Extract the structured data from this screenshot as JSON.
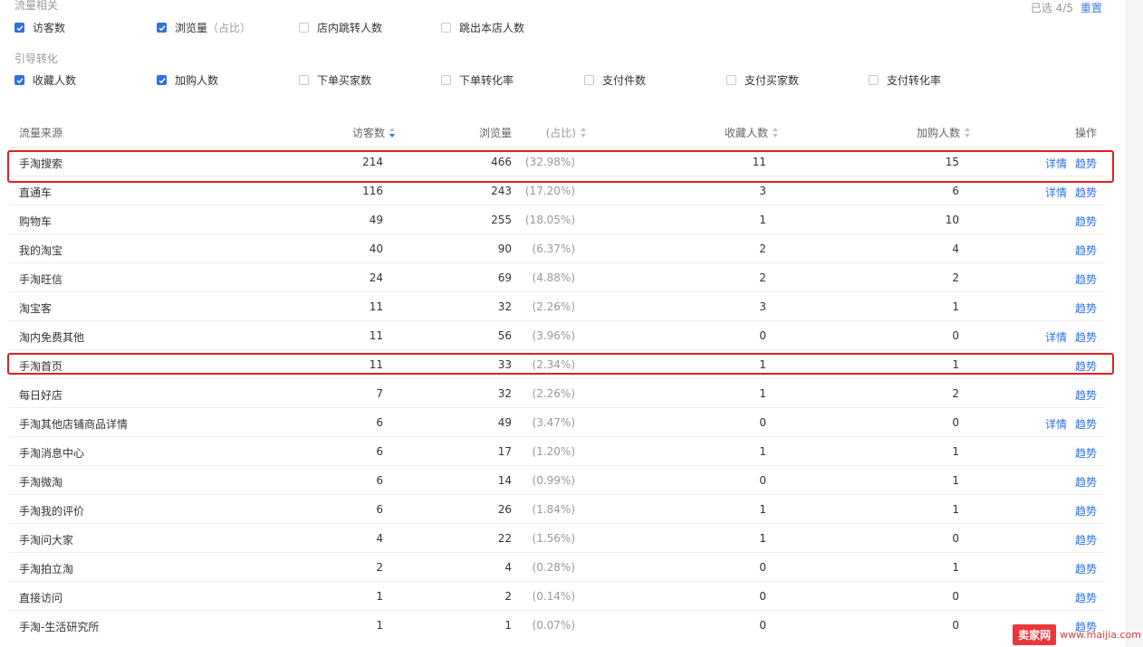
{
  "filters": {
    "traffic_title": "流量相关",
    "conversion_title": "引导转化",
    "selected_label": "已选 4/5",
    "reset_label": "重置",
    "traffic_options": [
      {
        "label": "访客数",
        "sub": "",
        "checked": true
      },
      {
        "label": "浏览量",
        "sub": "（占比）",
        "checked": true
      },
      {
        "label": "店内跳转人数",
        "sub": "",
        "checked": false
      },
      {
        "label": "跳出本店人数",
        "sub": "",
        "checked": false
      }
    ],
    "conversion_options": [
      {
        "label": "收藏人数",
        "checked": true
      },
      {
        "label": "加购人数",
        "checked": true
      },
      {
        "label": "下单买家数",
        "checked": false
      },
      {
        "label": "下单转化率",
        "checked": false
      },
      {
        "label": "支付件数",
        "checked": false
      },
      {
        "label": "支付买家数",
        "checked": false
      },
      {
        "label": "支付转化率",
        "checked": false
      }
    ]
  },
  "table": {
    "headers": {
      "source": "流量来源",
      "visitors": "访客数",
      "pv": "浏览量",
      "pct": "(占比)",
      "fav": "收藏人数",
      "cart": "加购人数",
      "ops": "操作"
    },
    "detail_label": "详情",
    "trend_label": "趋势",
    "rows": [
      {
        "source": "手淘搜索",
        "visitors": "214",
        "pv": "466",
        "pct": "(32.98%)",
        "fav": "11",
        "cart": "15",
        "detail": true
      },
      {
        "source": "直通车",
        "visitors": "116",
        "pv": "243",
        "pct": "(17.20%)",
        "fav": "3",
        "cart": "6",
        "detail": true
      },
      {
        "source": "购物车",
        "visitors": "49",
        "pv": "255",
        "pct": "(18.05%)",
        "fav": "1",
        "cart": "10",
        "detail": false
      },
      {
        "source": "我的淘宝",
        "visitors": "40",
        "pv": "90",
        "pct": "(6.37%)",
        "fav": "2",
        "cart": "4",
        "detail": false
      },
      {
        "source": "手淘旺信",
        "visitors": "24",
        "pv": "69",
        "pct": "(4.88%)",
        "fav": "2",
        "cart": "2",
        "detail": false
      },
      {
        "source": "淘宝客",
        "visitors": "11",
        "pv": "32",
        "pct": "(2.26%)",
        "fav": "3",
        "cart": "1",
        "detail": false
      },
      {
        "source": "淘内免费其他",
        "visitors": "11",
        "pv": "56",
        "pct": "(3.96%)",
        "fav": "0",
        "cart": "0",
        "detail": true
      },
      {
        "source": "手淘首页",
        "visitors": "11",
        "pv": "33",
        "pct": "(2.34%)",
        "fav": "1",
        "cart": "1",
        "detail": false
      },
      {
        "source": "每日好店",
        "visitors": "7",
        "pv": "32",
        "pct": "(2.26%)",
        "fav": "1",
        "cart": "2",
        "detail": false
      },
      {
        "source": "手淘其他店铺商品详情",
        "visitors": "6",
        "pv": "49",
        "pct": "(3.47%)",
        "fav": "0",
        "cart": "0",
        "detail": true
      },
      {
        "source": "手淘消息中心",
        "visitors": "6",
        "pv": "17",
        "pct": "(1.20%)",
        "fav": "1",
        "cart": "1",
        "detail": false
      },
      {
        "source": "手淘微淘",
        "visitors": "6",
        "pv": "14",
        "pct": "(0.99%)",
        "fav": "0",
        "cart": "1",
        "detail": false
      },
      {
        "source": "手淘我的评价",
        "visitors": "6",
        "pv": "26",
        "pct": "(1.84%)",
        "fav": "1",
        "cart": "1",
        "detail": false
      },
      {
        "source": "手淘问大家",
        "visitors": "4",
        "pv": "22",
        "pct": "(1.56%)",
        "fav": "1",
        "cart": "0",
        "detail": false
      },
      {
        "source": "手淘拍立淘",
        "visitors": "2",
        "pv": "4",
        "pct": "(0.28%)",
        "fav": "0",
        "cart": "1",
        "detail": false
      },
      {
        "source": "直接访问",
        "visitors": "1",
        "pv": "2",
        "pct": "(0.14%)",
        "fav": "0",
        "cart": "0",
        "detail": false
      },
      {
        "source": "手淘-生活研究所",
        "visitors": "1",
        "pv": "1",
        "pct": "(0.07%)",
        "fav": "0",
        "cart": "0",
        "detail": false
      }
    ],
    "highlighted_sources": [
      "手淘搜索",
      "手淘首页"
    ]
  },
  "watermark": {
    "badge": "卖家网",
    "url": "www.maijia.com"
  },
  "colors": {
    "accent": "#2f6fe0",
    "highlight": "#e02020"
  }
}
